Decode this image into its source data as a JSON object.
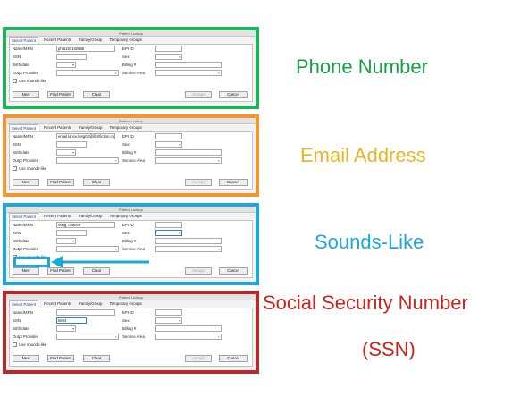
{
  "colors": {
    "green": "#1fb35a",
    "orange": "#f2952e",
    "blue": "#1ca8dd",
    "red": "#b8292a",
    "caption_green": "#1a9e47",
    "caption_orange": "#e7b526",
    "caption_blue": "#1ca8dd",
    "caption_red": "#c7251e"
  },
  "dialog": {
    "title": "Patient Lookup",
    "tabs": [
      "Select Patient",
      "Recent Patients",
      "Family/Group",
      "Temporary Groups"
    ],
    "labels": {
      "name_mrn": "Name/MRN",
      "ssn": "SSN",
      "birth_date": "Birth date",
      "outpt_provider": "Outpt Provider",
      "epi_id": "EPI ID",
      "sex": "Sex:",
      "billing": "Billing #",
      "service_area": "Service Area"
    },
    "sounds_like_label": "Use sounds-like",
    "buttons": {
      "new": "New",
      "find": "Find Patient",
      "clear": "Clear",
      "accept": "Accept",
      "cancel": "Cancel"
    }
  },
  "panels": [
    {
      "caption": "Phone Number",
      "name_value": "ph 6183182668",
      "ssn_value": "",
      "sounds_like_checked": ""
    },
    {
      "caption": "Email Address",
      "name_value": "email lance.long02@ifixitfiction.com",
      "ssn_value": "",
      "sounds_like_checked": ""
    },
    {
      "caption": "Sounds-Like",
      "name_value": "song, chance",
      "ssn_value": "",
      "sounds_like_checked": "✔"
    },
    {
      "caption": "Social Security Number",
      "caption2": "(SSN)",
      "name_value": "",
      "ssn_value": "5694",
      "sounds_like_checked": ""
    }
  ]
}
